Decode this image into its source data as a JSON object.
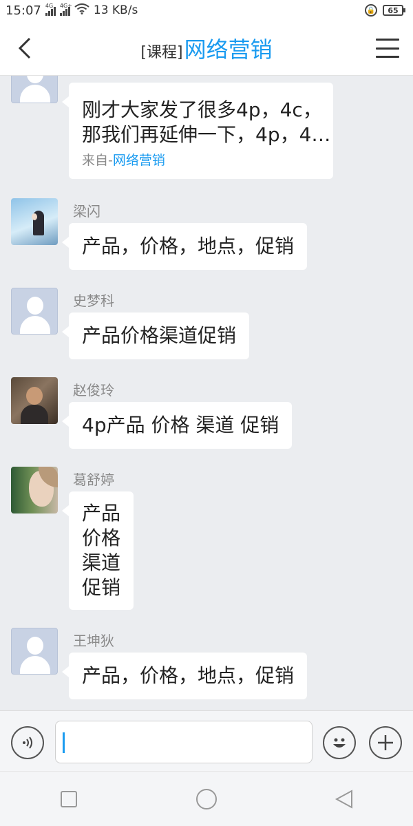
{
  "status_bar": {
    "time": "15:07",
    "network_1": "4G",
    "network_2": "4G+",
    "speed": "13 KB/s",
    "battery": "65"
  },
  "nav": {
    "title_prefix": "[课程]",
    "title_name": "网络营销"
  },
  "messages": [
    {
      "sender": "",
      "text_line1": "刚才大家发了很多4p，4c，",
      "text_line2": "那我们再延伸一下，4p，4…",
      "from_prefix": "来自-",
      "from_link": "网络营销"
    },
    {
      "sender": "梁闪",
      "lines": [
        "产品，价格，地点，促销"
      ]
    },
    {
      "sender": "史梦科",
      "lines": [
        "产品价格渠道促销"
      ]
    },
    {
      "sender": "赵俊玲",
      "lines": [
        "4p产品 价格 渠道 促销"
      ]
    },
    {
      "sender": "葛舒婷",
      "lines": [
        "产品",
        "价格",
        "渠道",
        "促销"
      ]
    },
    {
      "sender": "王坤狄",
      "lines": [
        "产品，价格，地点，促销"
      ]
    }
  ],
  "input": {
    "placeholder": ""
  },
  "colors": {
    "accent": "#1a9bf0",
    "background": "#ebedf0"
  }
}
